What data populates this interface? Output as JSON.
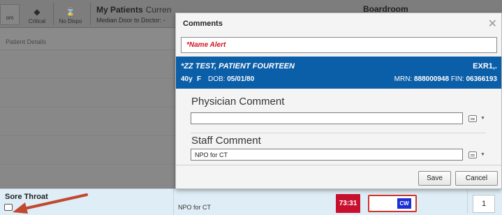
{
  "toolbar": {
    "left_stub_label": "om",
    "critical_label": "Critical",
    "no_dispo_label": "No Dispo",
    "list_title": "My Patients",
    "list_title_suffix": "Curren",
    "median_label": "Median Door to Doctor: -",
    "right_title": "Boardroom"
  },
  "columns": {
    "patient_details_header": "Patient Details"
  },
  "row": {
    "complaint": "Sore Throat",
    "comment_text": "NPO for CT",
    "timer": "73:31",
    "cw_label": "CW",
    "count": "1"
  },
  "dialog": {
    "title": "Comments",
    "name_alert": "*Name Alert",
    "patient": {
      "name": "*ZZ TEST, PATIENT FOURTEEN",
      "id_right": "EXR1,.",
      "age": "40y",
      "sex": "F",
      "dob_label": "DOB:",
      "dob": "05/01/80",
      "mrn_label": "MRN:",
      "mrn": "888000948",
      "fin_label": "FIN:",
      "fin": "06366193"
    },
    "physician_comment": {
      "title": "Physician Comment",
      "value": ""
    },
    "staff_comment": {
      "title": "Staff Comment",
      "value": "NPO for CT"
    },
    "save_label": "Save",
    "cancel_label": "Cancel"
  },
  "colors": {
    "banner": "#0b5ea8",
    "alert_red": "#d1121f",
    "timer_red": "#c8102e",
    "cw_blue": "#1a2fd6",
    "arrow": "#c0492f"
  }
}
